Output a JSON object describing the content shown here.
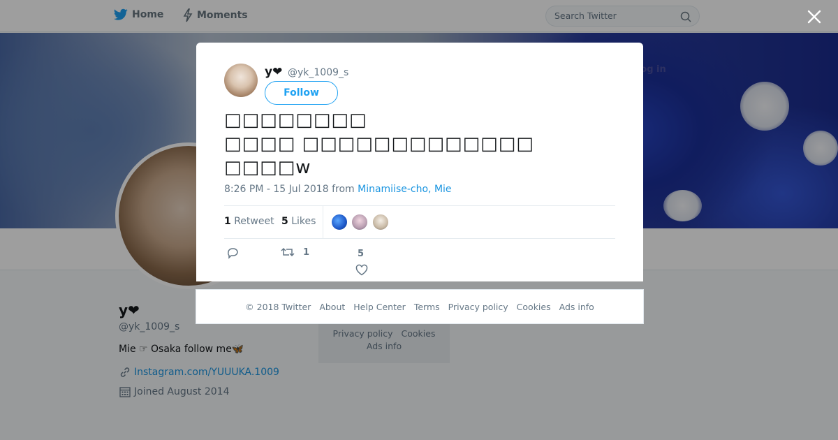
{
  "topbar": {
    "home_label": "Home",
    "moments_label": "Moments",
    "search_placeholder": "Search Twitter",
    "login_label": "Log in"
  },
  "profile": {
    "name": "y❤",
    "handle": "@yk_1009_s",
    "bio": "Mie ☞ Osaka follow me🦋",
    "link": "Instagram.com/YUUUKA.1009",
    "joined": "Joined August 2014"
  },
  "side_footer": {
    "row1": [
      "Privacy policy",
      "Cookies"
    ],
    "row2": [
      "Ads info"
    ]
  },
  "tweet": {
    "name": "y❤",
    "handle": "@yk_1009_s",
    "follow_label": "Follow",
    "text": "□□□□□□□□\n□□□□ □□□□□□□□□□□□□\n□□□□w",
    "time": "8:26 PM - 15 Jul 2018",
    "from_label": "from",
    "location": "Minamiise-cho, Mie",
    "retweet_count": "1",
    "retweet_label": "Retweet",
    "like_count": "5",
    "like_label": "Likes",
    "action_retweet_count": "1",
    "action_like_count": "5"
  },
  "footer": {
    "copyright": "© 2018 Twitter",
    "links": [
      "About",
      "Help Center",
      "Terms",
      "Privacy policy",
      "Cookies",
      "Ads info"
    ]
  },
  "colors": {
    "accent": "#1da1f2",
    "link": "#1b95e0",
    "muted": "#657786"
  },
  "icons": [
    "twitter-bird-icon",
    "lightning-icon",
    "search-icon",
    "close-icon",
    "reply-icon",
    "retweet-icon",
    "heart-icon",
    "link-icon",
    "calendar-icon"
  ]
}
